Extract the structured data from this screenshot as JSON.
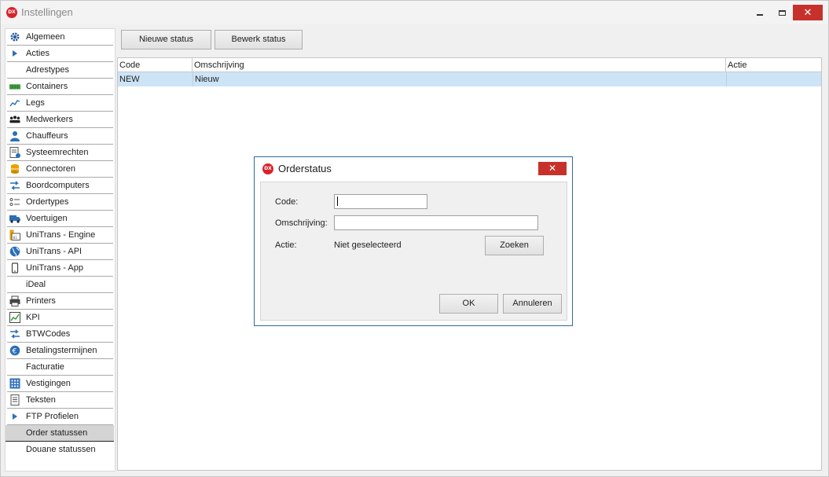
{
  "window": {
    "title": "Instellingen",
    "logo_text": "DX",
    "close_glyph": "✕"
  },
  "sidebar": {
    "items": [
      {
        "label": "Algemeen",
        "icon": "gear-icon"
      },
      {
        "label": "Acties",
        "icon": "triangle-right-icon"
      },
      {
        "label": "Adrestypes",
        "icon": ""
      },
      {
        "label": "Containers",
        "icon": "container-icon"
      },
      {
        "label": "Legs",
        "icon": "line-chart-icon"
      },
      {
        "label": "Medwerkers",
        "icon": "people-icon"
      },
      {
        "label": "Chauffeurs",
        "icon": "person-icon"
      },
      {
        "label": "Systeemrechten",
        "icon": "document-info-icon"
      },
      {
        "label": "Connectoren",
        "icon": "database-icon"
      },
      {
        "label": "Boordcomputers",
        "icon": "exchange-arrows-icon"
      },
      {
        "label": "Ordertypes",
        "icon": "list-icon"
      },
      {
        "label": "Voertuigen",
        "icon": "truck-icon"
      },
      {
        "label": "UniTrans - Engine",
        "icon": "engine-icon"
      },
      {
        "label": "UniTrans - API",
        "icon": "globe-icon"
      },
      {
        "label": "UniTrans - App",
        "icon": "mobile-icon"
      },
      {
        "label": "iDeal",
        "icon": ""
      },
      {
        "label": "Printers",
        "icon": "printer-icon"
      },
      {
        "label": "KPI",
        "icon": "chart-icon"
      },
      {
        "label": "BTWCodes",
        "icon": "exchange-arrows-icon"
      },
      {
        "label": "Betalingstermijnen",
        "icon": "euro-icon"
      },
      {
        "label": "Facturatie",
        "icon": ""
      },
      {
        "label": "Vestigingen",
        "icon": "building-icon"
      },
      {
        "label": "Teksten",
        "icon": "text-document-icon"
      },
      {
        "label": "FTP Profielen",
        "icon": "triangle-right-icon"
      },
      {
        "label": "Order statussen",
        "icon": ""
      },
      {
        "label": "Douane statussen",
        "icon": ""
      }
    ],
    "active_item": "Order statussen"
  },
  "toolbar": {
    "new_status_label": "Nieuwe status",
    "edit_status_label": "Bewerk status"
  },
  "grid": {
    "columns": [
      "Code",
      "Omschrijving",
      "Actie"
    ],
    "rows": [
      {
        "code": "NEW",
        "description": "Nieuw",
        "action": ""
      }
    ]
  },
  "dialog": {
    "title": "Orderstatus",
    "logo_text": "DX",
    "close_glyph": "✕",
    "code_label": "Code:",
    "code_value": "",
    "description_label": "Omschrijving:",
    "description_value": "",
    "action_label": "Actie:",
    "action_value": "Niet geselecteerd",
    "search_label": "Zoeken",
    "ok_label": "OK",
    "cancel_label": "Annuleren"
  },
  "colors": {
    "accent_red": "#c7312c",
    "selection_blue": "#cde4f7",
    "dialog_border": "#2f6aa0"
  }
}
